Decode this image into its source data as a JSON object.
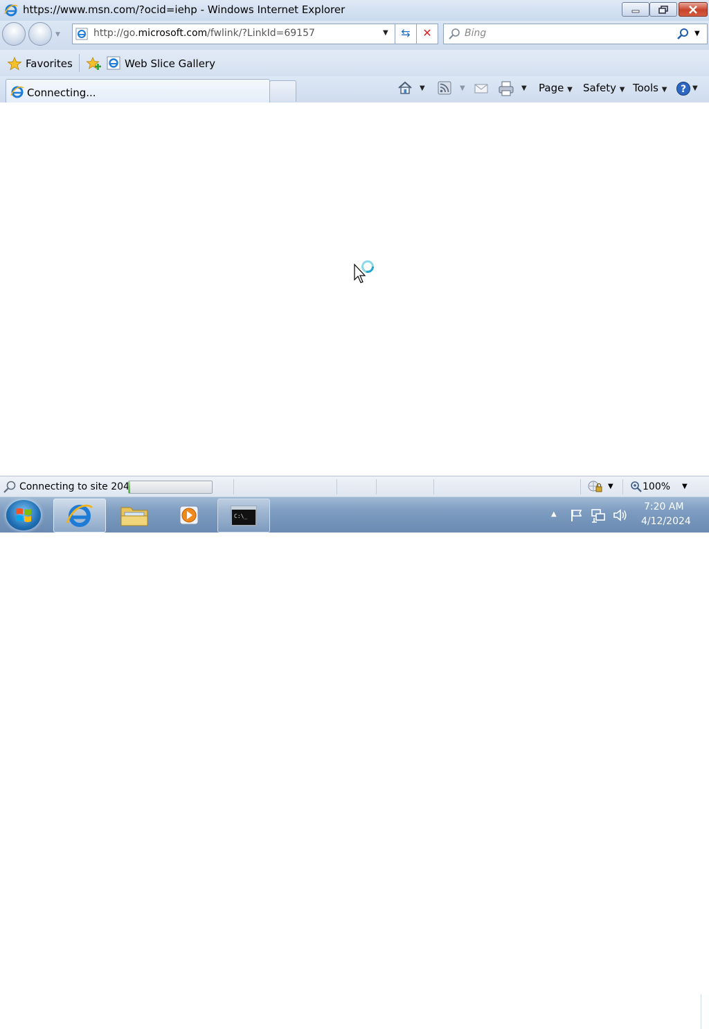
{
  "window": {
    "title": "https://www.msn.com/?ocid=iehp - Windows Internet Explorer",
    "controls": [
      "minimize",
      "restore",
      "close"
    ]
  },
  "navigation": {
    "address": "http://go.microsoft.com/fwlink/?LinkId=69157",
    "address_parts": {
      "pre": "http://go.",
      "domain": "microsoft.com",
      "post": "/fwlink/?LinkId=69157"
    },
    "search_placeholder": "Bing"
  },
  "favorites_bar": {
    "favorites_label": "Favorites",
    "items": [
      {
        "label": "Web Slice Gallery"
      }
    ]
  },
  "tabs": [
    {
      "label": "Connecting...",
      "active": true
    }
  ],
  "command_bar": {
    "page_label": "Page",
    "safety_label": "Safety",
    "tools_label": "Tools"
  },
  "status_bar": {
    "status_text": "Connecting to site 204",
    "progress": 0.02,
    "zoom": "100%"
  },
  "taskbar": {
    "pinned": [
      "internet-explorer",
      "windows-explorer",
      "media-player",
      "command-prompt"
    ],
    "clock_time": "7:20 AM",
    "clock_date": "4/12/2024"
  },
  "colors": {
    "chrome": "#d4e0f0",
    "taskbar": "#7d9cc0",
    "progress": "#3fb52a"
  }
}
